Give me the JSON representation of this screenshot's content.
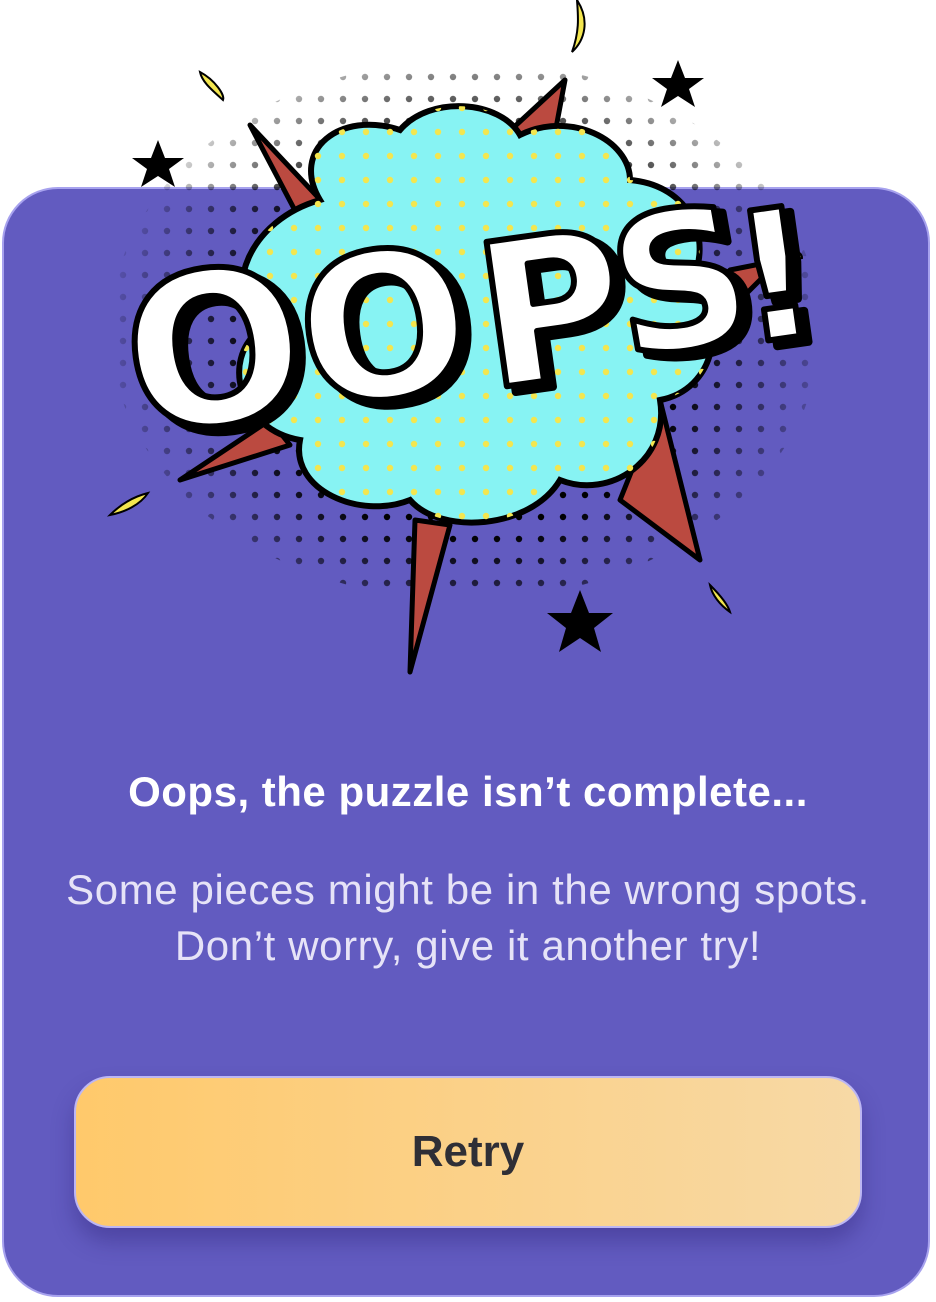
{
  "illustration": {
    "word": "OOPS!",
    "letters": [
      "O",
      "O",
      "P",
      "S",
      "!"
    ]
  },
  "dialog": {
    "title": "Oops, the puzzle isn’t complete...",
    "message": "Some pieces might be in the wrong spots. Don’t worry, give it another try!",
    "retry_label": "Retry"
  },
  "colors": {
    "card": "#625bc0",
    "card_border": "#a7a2ee",
    "cloud": "#87f3f3",
    "cloud_dots": "#f3e64f",
    "burst": "#bb4a40",
    "button_start": "#ffc96b",
    "button_end": "#f7d9a6",
    "button_text": "#2f2f36"
  }
}
